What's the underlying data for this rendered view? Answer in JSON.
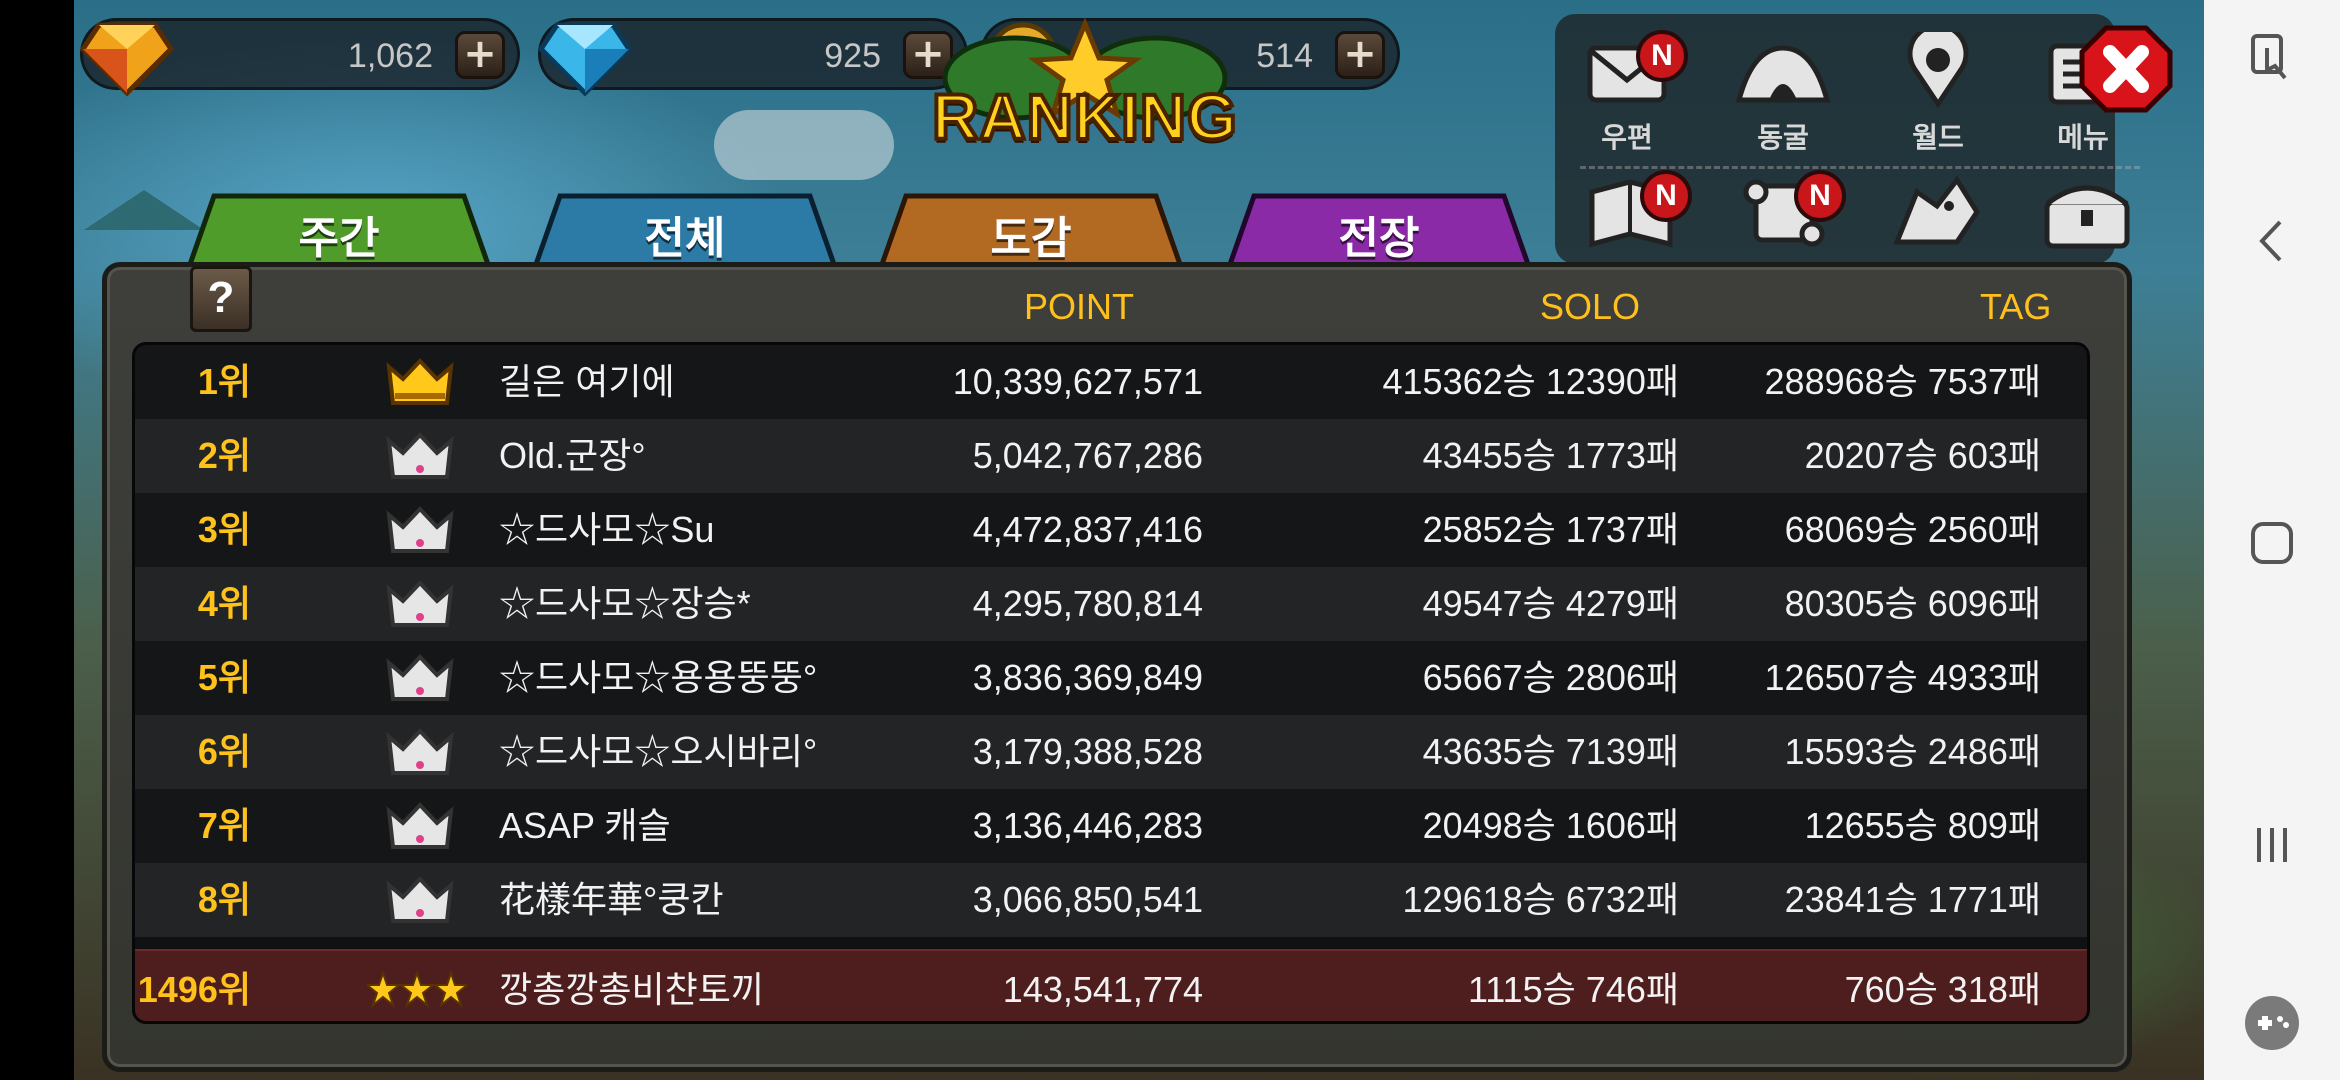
{
  "currency": [
    {
      "name": "gold-gem",
      "value": "1,062"
    },
    {
      "name": "blue-diamond",
      "value": "925"
    },
    {
      "name": "coin",
      "value": "514"
    }
  ],
  "header": {
    "title": "RANKING"
  },
  "menu": {
    "top": [
      {
        "label": "우편",
        "badge": "N"
      },
      {
        "label": "동굴",
        "badge": ""
      },
      {
        "label": "월드",
        "badge": ""
      },
      {
        "label": "메뉴",
        "badge": ""
      }
    ],
    "bottom_badges": [
      "N",
      "N"
    ]
  },
  "tabs": [
    {
      "label": "주간",
      "color": "#4f9c2b"
    },
    {
      "label": "전체",
      "color": "#2b7ba6"
    },
    {
      "label": "도감",
      "color": "#b26a23"
    },
    {
      "label": "전장",
      "color": "#8a2aa6"
    }
  ],
  "table": {
    "help": "?",
    "columns": {
      "point": "POINT",
      "solo": "SOLO",
      "tag": "TAG"
    },
    "rows": [
      {
        "rank": "1위",
        "badge": "gold-crown",
        "name": "길은 여기에",
        "point": "10,339,627,571",
        "solo": "415362승 12390패",
        "tag": "288968승 7537패"
      },
      {
        "rank": "2위",
        "badge": "silver-crown",
        "name": "Old.군장°",
        "point": "5,042,767,286",
        "solo": "43455승 1773패",
        "tag": "20207승 603패"
      },
      {
        "rank": "3위",
        "badge": "silver-crown",
        "name": "☆드사모☆Su",
        "point": "4,472,837,416",
        "solo": "25852승 1737패",
        "tag": "68069승 2560패"
      },
      {
        "rank": "4위",
        "badge": "silver-crown",
        "name": "☆드사모☆장승*",
        "point": "4,295,780,814",
        "solo": "49547승 4279패",
        "tag": "80305승 6096패"
      },
      {
        "rank": "5위",
        "badge": "silver-crown",
        "name": "☆드사모☆용용뚱뚱°",
        "point": "3,836,369,849",
        "solo": "65667승 2806패",
        "tag": "126507승 4933패"
      },
      {
        "rank": "6위",
        "badge": "silver-crown",
        "name": "☆드사모☆오시바리°",
        "point": "3,179,388,528",
        "solo": "43635승 7139패",
        "tag": "15593승 2486패"
      },
      {
        "rank": "7위",
        "badge": "silver-crown",
        "name": "ASAP 캐슬",
        "point": "3,136,446,283",
        "solo": "20498승 1606패",
        "tag": "12655승 809패"
      },
      {
        "rank": "8위",
        "badge": "silver-crown",
        "name": "花樣年華°쿵칸",
        "point": "3,066,850,541",
        "solo": "129618승 6732패",
        "tag": "23841승 1771패"
      }
    ],
    "me": {
      "rank": "1496위",
      "badge": "three-stars",
      "name": "깡총깡총비챤토끼",
      "point": "143,541,774",
      "solo": "1115승 746패",
      "tag": "760승 318패"
    }
  }
}
